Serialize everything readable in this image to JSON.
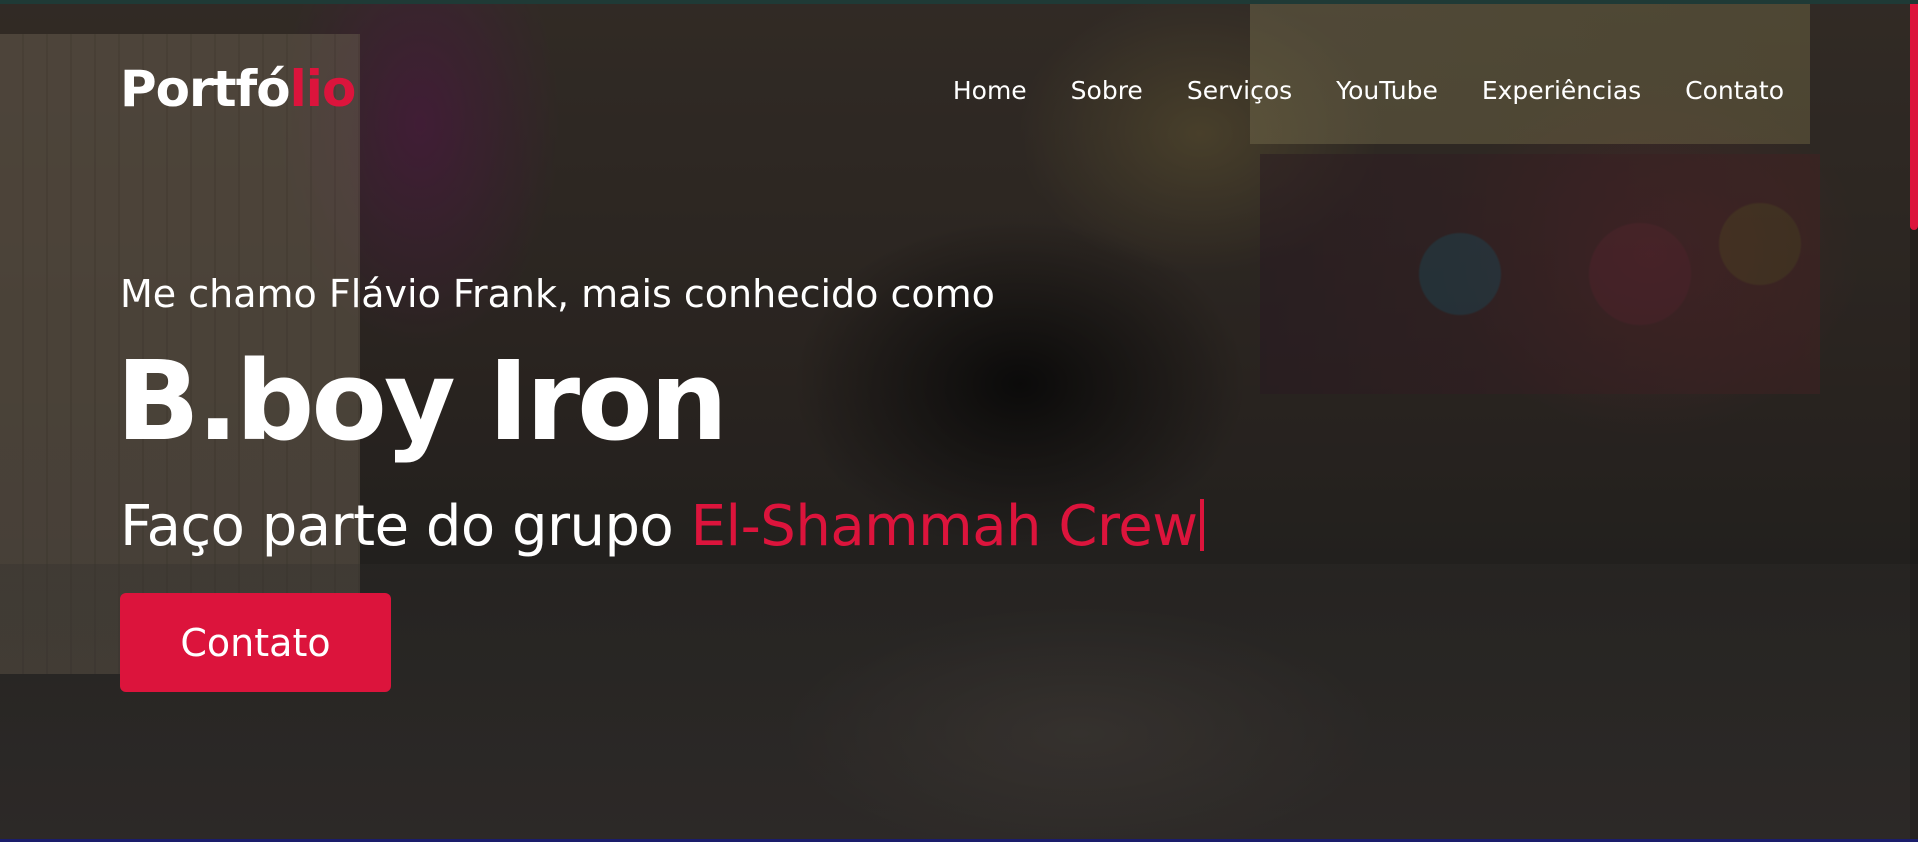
{
  "navbar": {
    "logo": {
      "main": "Portfó",
      "accent": "lio"
    },
    "menu": [
      {
        "label": "Home"
      },
      {
        "label": "Sobre"
      },
      {
        "label": "Serviços"
      },
      {
        "label": "YouTube"
      },
      {
        "label": "Experiências"
      },
      {
        "label": "Contato"
      }
    ]
  },
  "hero": {
    "intro": "Me chamo Flávio Frank, mais conhecido como",
    "name": "B.boy Iron",
    "group_prefix": "Faço parte do grupo ",
    "group_highlight": "El-Shammah Crew",
    "button_label": "Contato"
  },
  "colors": {
    "accent": "#dc143c",
    "text": "#ffffff"
  }
}
